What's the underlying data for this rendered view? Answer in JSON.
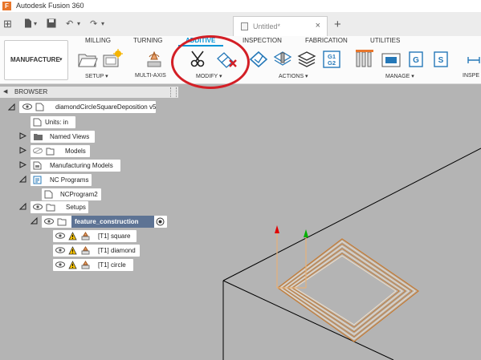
{
  "app": {
    "title": "Autodesk Fusion 360",
    "icon": "fusion-logo-icon"
  },
  "document": {
    "tab_label": "Untitled*",
    "close_glyph": "×",
    "new_tab_glyph": "+"
  },
  "quick_access": {
    "grid": "⊞",
    "undo": "↶",
    "redo": "↷",
    "save_caret": "▾",
    "undo_caret": "▾",
    "redo_caret": "▾"
  },
  "workspace": {
    "label": "MANUFACTURE",
    "caret": "▾"
  },
  "ribbon": {
    "tabs": [
      {
        "label": "MILLING",
        "active": false
      },
      {
        "label": "TURNING",
        "active": false
      },
      {
        "label": "ADDITIVE",
        "active": true
      },
      {
        "label": "INSPECTION",
        "active": false
      },
      {
        "label": "FABRICATION",
        "active": false
      },
      {
        "label": "UTILITIES",
        "active": false
      }
    ],
    "groups": [
      {
        "label": "SETUP ▾"
      },
      {
        "label": "MULTI-AXIS"
      },
      {
        "label": "MODIFY ▾"
      },
      {
        "label": "ACTIONS ▾"
      },
      {
        "label": "MANAGE ▾"
      },
      {
        "label": "INSPE"
      }
    ],
    "g1g2_text": "G1\nG2",
    "accent_color": "#0696d7",
    "highlight_color": "#d31f26"
  },
  "browser": {
    "header_arrow": "◀",
    "header_label": "BROWSER",
    "nodes": [
      {
        "label": "diamondCircleSquareDeposition v5"
      },
      {
        "label": "Units: in"
      },
      {
        "label": "Named Views"
      },
      {
        "label": "Models"
      },
      {
        "label": "Manufacturing Models"
      },
      {
        "label": "NC Programs"
      },
      {
        "label": "NCProgram2"
      },
      {
        "label": "Setups"
      },
      {
        "label": "feature_construction"
      },
      {
        "label": "[T1] square"
      },
      {
        "label": "[T1] diamond"
      },
      {
        "label": "[T1] circle"
      }
    ],
    "active_node_color": "#5d7394"
  }
}
